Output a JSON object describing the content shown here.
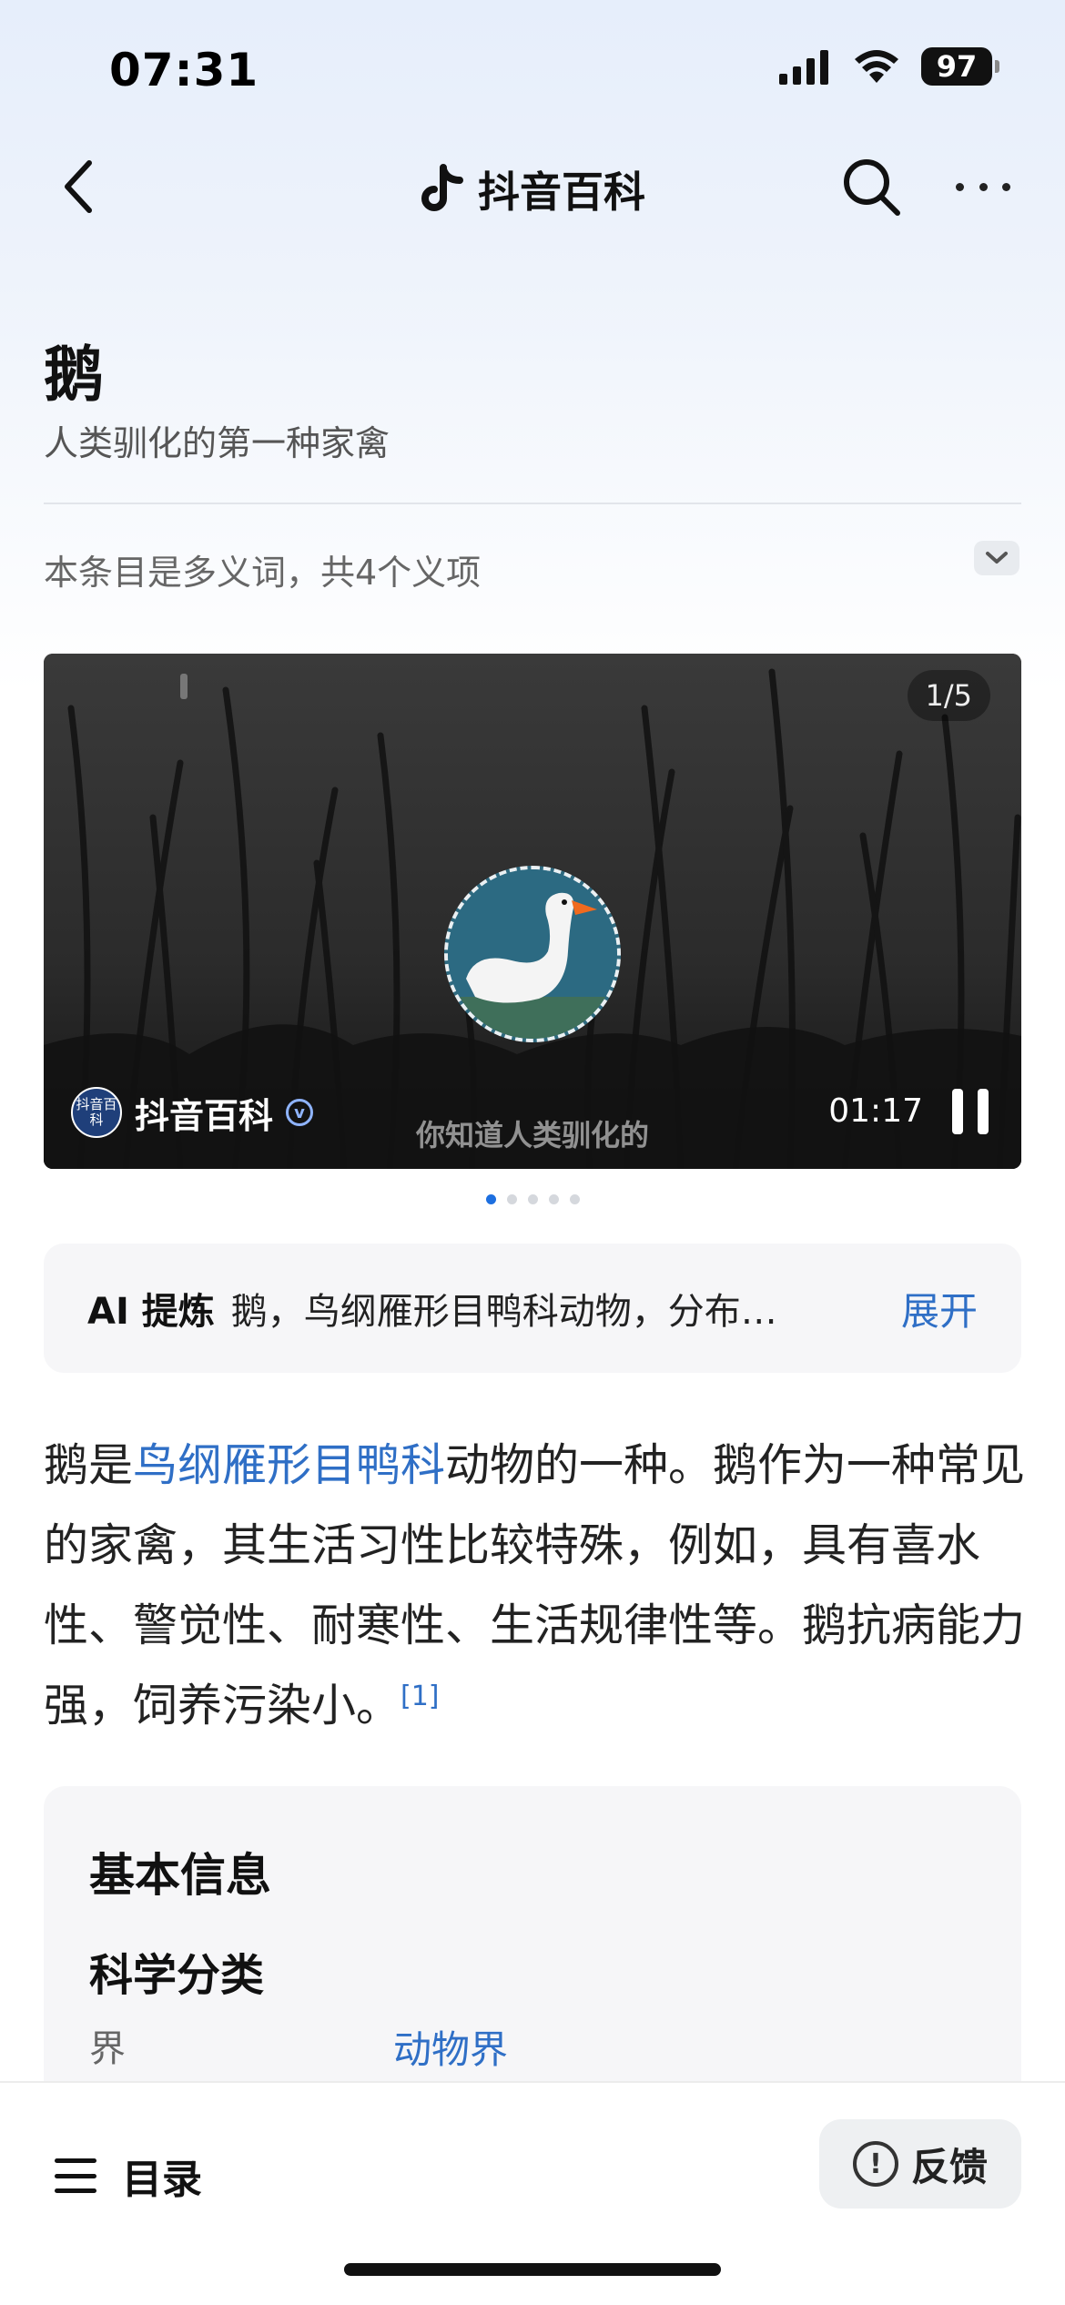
{
  "status_bar": {
    "time": "07:31",
    "battery": "97",
    "icons": [
      "signal-icon",
      "wifi-icon",
      "battery-icon"
    ]
  },
  "nav": {
    "title": "抖音百科",
    "icons": [
      "back-icon",
      "tiktok-logo-icon",
      "search-icon",
      "more-icon"
    ]
  },
  "entry": {
    "headword": "鹅",
    "subtitle": "人类驯化的第一种家禽",
    "polysemy_note": "本条目是多义词，共4个义项"
  },
  "video": {
    "counter": "1/5",
    "brand_logo_text": "抖音百科",
    "brand_name": "抖音百科",
    "caption": "你知道人类驯化的",
    "duration": "01:17",
    "pages": 5,
    "current_page": 1
  },
  "ai_summary": {
    "label": "AI 提炼",
    "text": "鹅，鸟纲雁形目鸭科动物，分布…",
    "expand": "展开"
  },
  "article": {
    "p1_a": "鹅是",
    "p1_link": "鸟纲雁形目鸭科",
    "p1_b": "动物的一种。鹅作为一种常见的家禽，其生活习性比较特殊，例如，具有喜水性、警觉性、耐寒性、生活规律性等。鹅抗病能力强，饲养污染小。",
    "ref": "[1]"
  },
  "info_card": {
    "title": "基本信息",
    "section": "科学分类",
    "rows": [
      {
        "key": "界",
        "value": "动物界"
      }
    ]
  },
  "bottom_bar": {
    "toc_label": "目录",
    "feedback_label": "反馈"
  },
  "colors": {
    "link": "#2f6fc6",
    "page_dot_active": "#1d6fe0"
  }
}
